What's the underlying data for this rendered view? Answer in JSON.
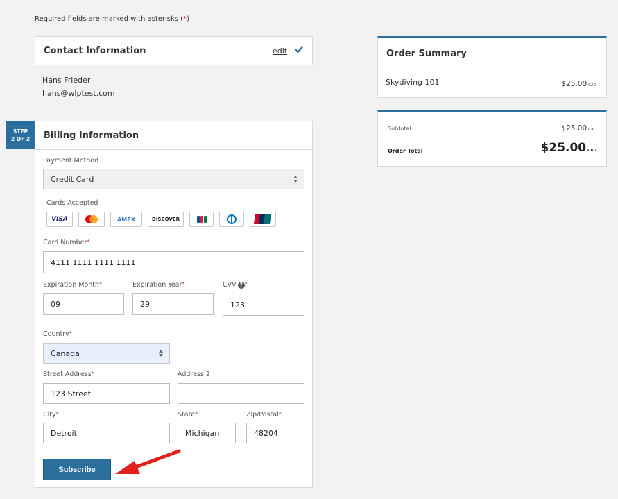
{
  "required_note": {
    "text": "Required fields are marked with asterisks (",
    "asterisk": "*",
    "close": ")"
  },
  "contact": {
    "title": "Contact Information",
    "edit_label": "edit",
    "name": "Hans Frieder",
    "email": "hans@wlptest.com"
  },
  "step": {
    "line1": "STEP",
    "line2": "2 OF 2"
  },
  "billing": {
    "title": "Billing Information",
    "payment_method_label": "Payment Method",
    "payment_method_value": "Credit Card",
    "cards_label": "Cards Accepted",
    "cards": [
      {
        "name": "VISA",
        "color": "#1a1f71"
      },
      {
        "name": "mastercard",
        "color": "#eb001b"
      },
      {
        "name": "AMEX",
        "color": "#2e77bb"
      },
      {
        "name": "DISCOVER",
        "color": "#222222"
      },
      {
        "name": "JCB",
        "color": "#0e4c96"
      },
      {
        "name": "Diners Club",
        "color": "#0079be"
      },
      {
        "name": "UnionPay",
        "color": "#d10429"
      }
    ],
    "card_number_label": "Card Number",
    "card_number_value": "4111 1111 1111 1111",
    "exp_month_label": "Expiration Month",
    "exp_month_value": "09",
    "exp_year_label": "Expiration Year",
    "exp_year_value": "29",
    "cvv_label": "CVV",
    "cvv_value": "123",
    "country_label": "Country",
    "country_value": "Canada",
    "street_label": "Street Address",
    "street_value": "123 Street",
    "address2_label": "Address 2",
    "address2_value": "",
    "city_label": "City",
    "city_value": "Detroit",
    "state_label": "State",
    "state_value": "Michigan",
    "zip_label": "Zip/Postal",
    "zip_value": "48204",
    "subscribe_label": "Subscribe"
  },
  "summary": {
    "title": "Order Summary",
    "item_name": "Skydiving 101",
    "item_price": "$25.00",
    "currency": "CAD",
    "subtotal_label": "Subtotal",
    "subtotal_value": "$25.00",
    "total_label": "Order Total",
    "total_value": "$25.00"
  },
  "colors": {
    "accent": "#2a6f9e",
    "required": "#c0392b",
    "annotation_arrow": "#e3201b"
  }
}
